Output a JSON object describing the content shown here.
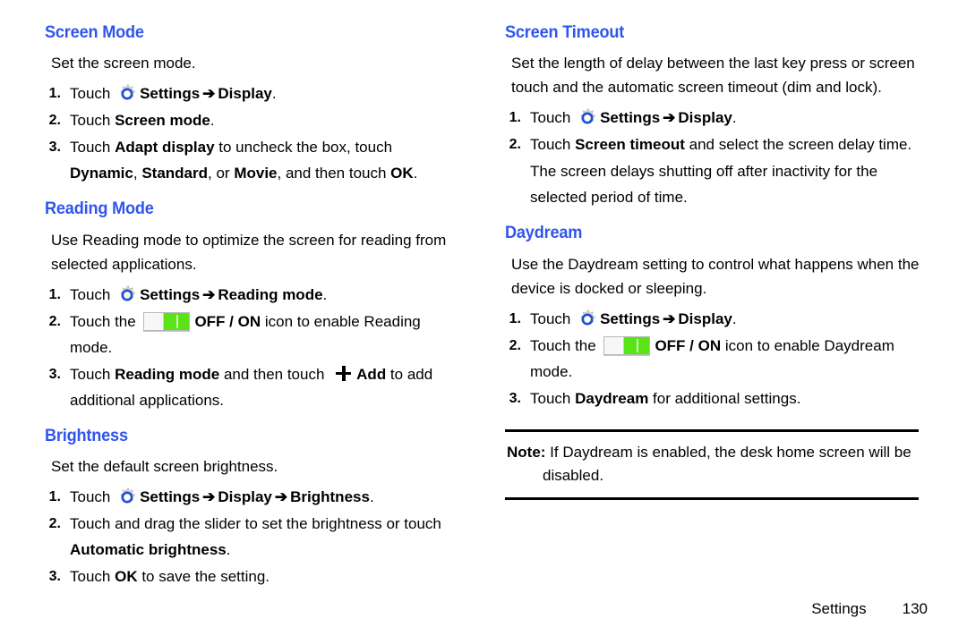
{
  "document": {
    "type": "user-manual-page",
    "footer": {
      "label": "Settings",
      "page_number": "130"
    }
  },
  "icons": {
    "gear": "settings-gear-icon",
    "arrow": "➔",
    "toggle": "off-on-toggle-icon",
    "plus": "add-plus-icon"
  },
  "colors": {
    "heading_blue": "#2f55ee",
    "toggle_green": "#5ae418",
    "gear_ring_blue": "#1a4fd8",
    "text_black": "#000000"
  },
  "left_column": {
    "sections": [
      {
        "heading": "Screen Mode",
        "intro": "Set the screen mode.",
        "steps": [
          {
            "num": "1.",
            "parts": [
              {
                "t": "text",
                "v": "Touch "
              },
              {
                "t": "icon",
                "v": "gear"
              },
              {
                "t": "bold",
                "v": "Settings"
              },
              {
                "t": "arrow",
                "v": "➔"
              },
              {
                "t": "bold",
                "v": "Display"
              },
              {
                "t": "text",
                "v": "."
              }
            ]
          },
          {
            "num": "2.",
            "parts": [
              {
                "t": "text",
                "v": "Touch "
              },
              {
                "t": "bold",
                "v": "Screen mode"
              },
              {
                "t": "text",
                "v": "."
              }
            ]
          },
          {
            "num": "3.",
            "parts": [
              {
                "t": "text",
                "v": "Touch "
              },
              {
                "t": "bold",
                "v": "Adapt display"
              },
              {
                "t": "text",
                "v": " to uncheck the box, touch "
              },
              {
                "t": "bold",
                "v": "Dynamic"
              },
              {
                "t": "text",
                "v": ", "
              },
              {
                "t": "bold",
                "v": "Standard"
              },
              {
                "t": "text",
                "v": ", or "
              },
              {
                "t": "bold",
                "v": "Movie"
              },
              {
                "t": "text",
                "v": ", and then touch "
              },
              {
                "t": "bold",
                "v": "OK"
              },
              {
                "t": "text",
                "v": "."
              }
            ]
          }
        ]
      },
      {
        "heading": "Reading Mode",
        "intro": "Use Reading mode to optimize the screen for reading from selected applications.",
        "steps": [
          {
            "num": "1.",
            "parts": [
              {
                "t": "text",
                "v": "Touch "
              },
              {
                "t": "icon",
                "v": "gear"
              },
              {
                "t": "bold",
                "v": "Settings"
              },
              {
                "t": "arrow",
                "v": "➔"
              },
              {
                "t": "bold",
                "v": "Reading mode"
              },
              {
                "t": "text",
                "v": "."
              }
            ]
          },
          {
            "num": "2.",
            "parts": [
              {
                "t": "text",
                "v": "Touch the "
              },
              {
                "t": "icon",
                "v": "toggle"
              },
              {
                "t": "bold",
                "v": "OFF / ON"
              },
              {
                "t": "text",
                "v": " icon to enable Reading mode."
              }
            ]
          },
          {
            "num": "3.",
            "parts": [
              {
                "t": "text",
                "v": "Touch "
              },
              {
                "t": "bold",
                "v": "Reading mode"
              },
              {
                "t": "text",
                "v": " and then touch "
              },
              {
                "t": "icon",
                "v": "plus"
              },
              {
                "t": "bold",
                "v": "Add"
              },
              {
                "t": "text",
                "v": " to add additional applications."
              }
            ]
          }
        ]
      },
      {
        "heading": "Brightness",
        "intro": "Set the default screen brightness.",
        "steps": [
          {
            "num": "1.",
            "parts": [
              {
                "t": "text",
                "v": "Touch "
              },
              {
                "t": "icon",
                "v": "gear"
              },
              {
                "t": "bold",
                "v": "Settings"
              },
              {
                "t": "arrow",
                "v": "➔"
              },
              {
                "t": "bold",
                "v": "Display"
              },
              {
                "t": "arrow",
                "v": "➔"
              },
              {
                "t": "bold",
                "v": "Brightness"
              },
              {
                "t": "text",
                "v": "."
              }
            ]
          },
          {
            "num": "2.",
            "parts": [
              {
                "t": "text",
                "v": "Touch and drag the slider to set the brightness or touch "
              },
              {
                "t": "bold",
                "v": "Automatic brightness"
              },
              {
                "t": "text",
                "v": "."
              }
            ]
          },
          {
            "num": "3.",
            "parts": [
              {
                "t": "text",
                "v": "Touch "
              },
              {
                "t": "bold",
                "v": "OK"
              },
              {
                "t": "text",
                "v": " to save the setting."
              }
            ]
          }
        ]
      }
    ]
  },
  "right_column": {
    "sections": [
      {
        "heading": "Screen Timeout",
        "intro": "Set the length of delay between the last key press or screen touch and the automatic screen timeout (dim and lock).",
        "steps": [
          {
            "num": "1.",
            "parts": [
              {
                "t": "text",
                "v": "Touch "
              },
              {
                "t": "icon",
                "v": "gear"
              },
              {
                "t": "bold",
                "v": "Settings"
              },
              {
                "t": "arrow",
                "v": "➔"
              },
              {
                "t": "bold",
                "v": "Display"
              },
              {
                "t": "text",
                "v": "."
              }
            ]
          },
          {
            "num": "2.",
            "parts": [
              {
                "t": "text",
                "v": "Touch "
              },
              {
                "t": "bold",
                "v": "Screen timeout"
              },
              {
                "t": "text",
                "v": " and select the screen delay time."
              }
            ]
          },
          {
            "num": "",
            "continuation": true,
            "parts": [
              {
                "t": "text",
                "v": "The screen delays shutting off after inactivity for the selected period of time."
              }
            ]
          }
        ]
      },
      {
        "heading": "Daydream",
        "intro": "Use the Daydream setting to control what happens when the device is docked or sleeping.",
        "steps": [
          {
            "num": "1.",
            "parts": [
              {
                "t": "text",
                "v": "Touch "
              },
              {
                "t": "icon",
                "v": "gear"
              },
              {
                "t": "bold",
                "v": "Settings"
              },
              {
                "t": "arrow",
                "v": "➔"
              },
              {
                "t": "bold",
                "v": "Display"
              },
              {
                "t": "text",
                "v": "."
              }
            ]
          },
          {
            "num": "2.",
            "parts": [
              {
                "t": "text",
                "v": "Touch the "
              },
              {
                "t": "icon",
                "v": "toggle"
              },
              {
                "t": "bold",
                "v": "OFF / ON"
              },
              {
                "t": "text",
                "v": " icon to enable Daydream mode."
              }
            ]
          },
          {
            "num": "3.",
            "parts": [
              {
                "t": "text",
                "v": "Touch "
              },
              {
                "t": "bold",
                "v": "Daydream"
              },
              {
                "t": "text",
                "v": " for additional settings."
              }
            ]
          }
        ]
      }
    ],
    "note": {
      "label": "Note:",
      "line1": "If Daydream is enabled, the desk home screen will be",
      "line2": "disabled."
    }
  }
}
